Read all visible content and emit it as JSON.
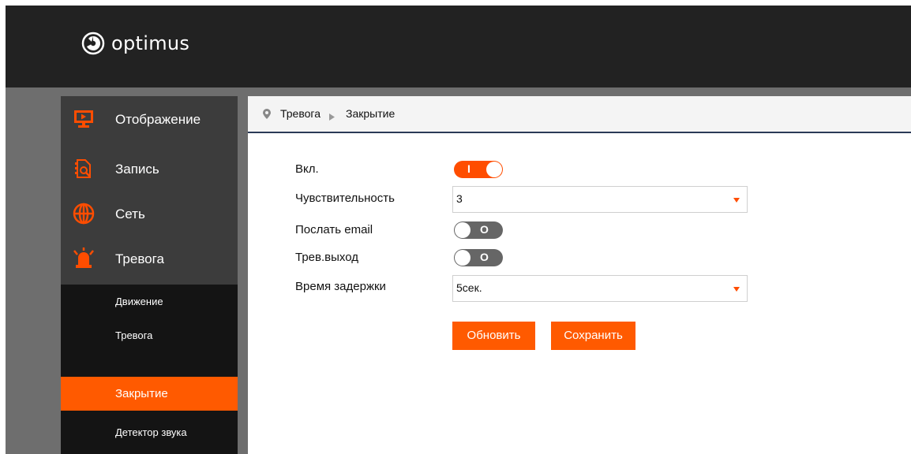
{
  "brand": {
    "name": "optimus",
    "accent": "#ff5a00"
  },
  "sidebar": {
    "main_items": [
      {
        "label": "Отображение",
        "icon": "monitor-icon"
      },
      {
        "label": "Запись",
        "icon": "record-search-icon"
      },
      {
        "label": "Сеть",
        "icon": "globe-icon"
      },
      {
        "label": "Тревога",
        "icon": "alarm-bell-icon"
      }
    ],
    "sub_items": [
      {
        "label": "Движение"
      },
      {
        "label": "Тревога"
      },
      {
        "label": "Закрытие",
        "active": true
      },
      {
        "label": "Детектор звука"
      }
    ]
  },
  "breadcrumb": {
    "section": "Тревога",
    "page": "Закрытие"
  },
  "form": {
    "enable": {
      "label": "Вкл.",
      "state": "on",
      "mark": "I"
    },
    "sensitivity": {
      "label": "Чувствительность",
      "value": "3"
    },
    "send_email": {
      "label": "Послать email",
      "state": "off",
      "mark": "O"
    },
    "alarm_out": {
      "label": "Трев.выход",
      "state": "off",
      "mark": "O"
    },
    "delay": {
      "label": "Время задержки",
      "value": "5сек."
    }
  },
  "buttons": {
    "refresh": "Обновить",
    "save": "Сохранить"
  }
}
